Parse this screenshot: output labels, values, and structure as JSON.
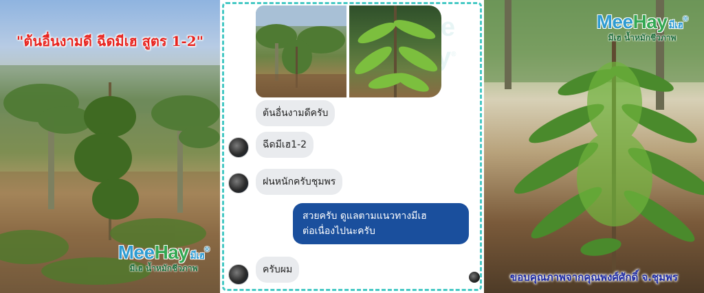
{
  "left_photo": {
    "caption": "\"ต้นอื่นงามดี ฉีดมีเฮ สูตร 1-2\""
  },
  "logo": {
    "wordmark_a": "Mee",
    "wordmark_b": "Hay",
    "thai_mark": "มีเฮ",
    "tagline": "มีเฮ น้ำหมักชีวภาพ",
    "registered": "®"
  },
  "chat": {
    "messages": [
      {
        "side": "them",
        "text": "ต้นอื่นงามดีครับ"
      },
      {
        "side": "them",
        "text": "ฉีดมีเฮ1-2"
      },
      {
        "side": "them",
        "text": "ฝนหนักครับชุมพร"
      },
      {
        "side": "me",
        "line1": "สวยครับ ดูแลตามแนวทางมีเฮ",
        "line2": "ต่อเนื่องไปนะครับ"
      },
      {
        "side": "them",
        "text": "ครับผม"
      }
    ]
  },
  "right_photo": {
    "credit": "ขอบคุณภาพจากคุณพงศ์ศักดิ์ จ.ชุมพร"
  },
  "colors": {
    "accent_teal": "#45c8c4",
    "bubble_me": "#1a4f9d",
    "bubble_them": "#e9ebee",
    "caption_red": "#e8231e",
    "credit_blue": "#1e2ba3"
  }
}
